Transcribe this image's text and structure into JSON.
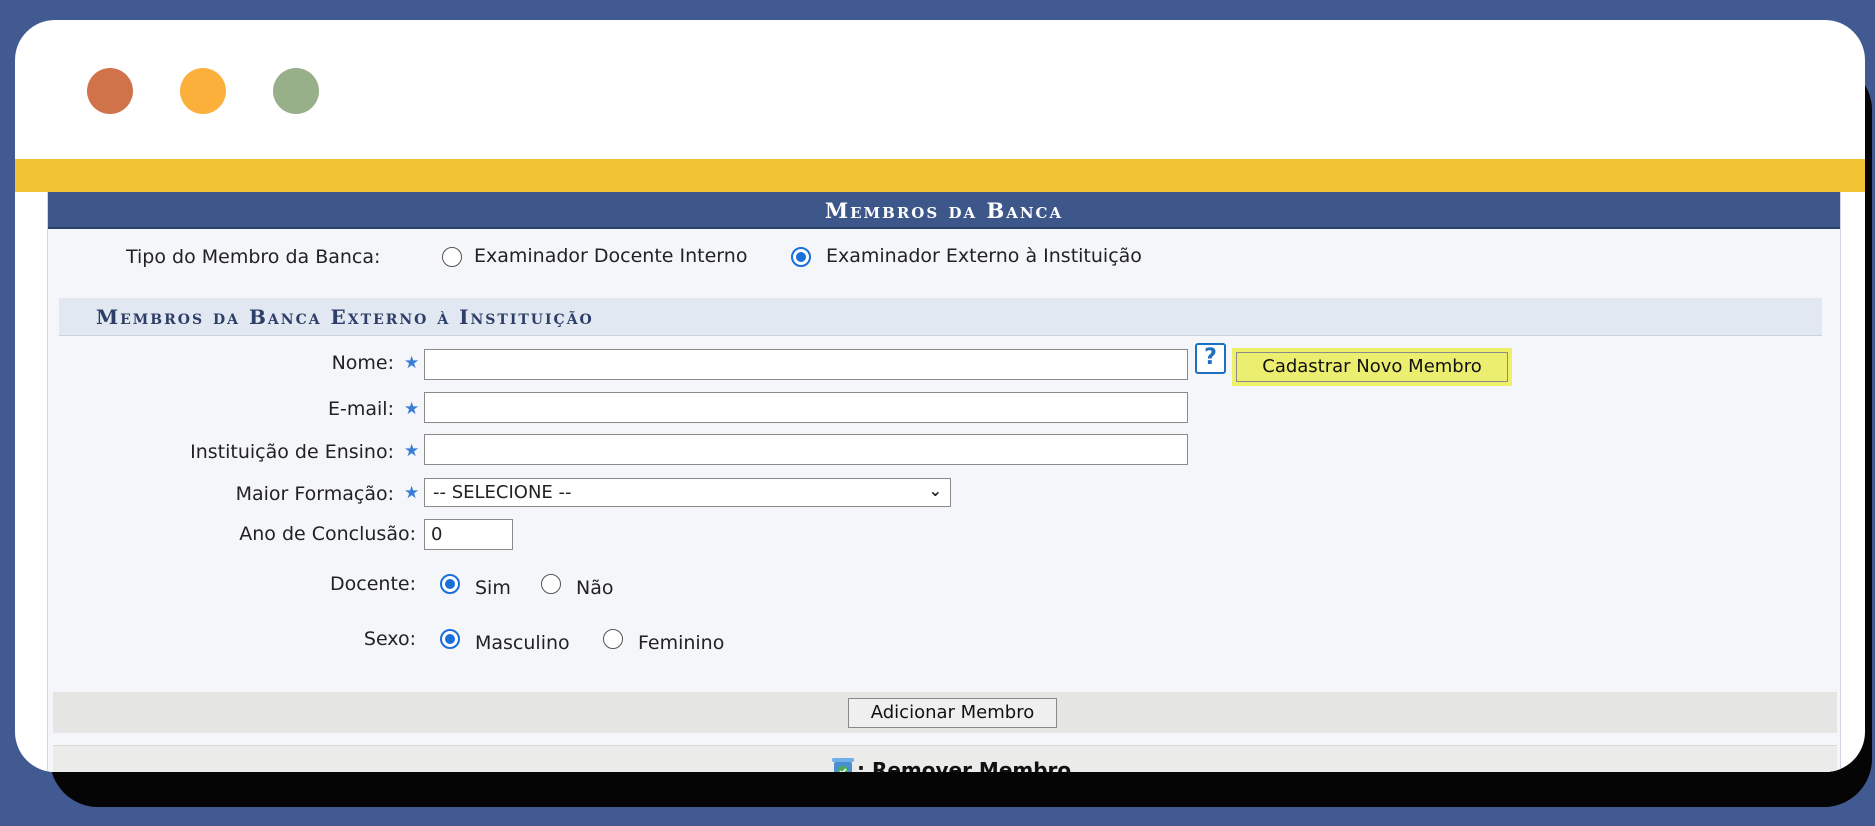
{
  "panel": {
    "title": "Membros da Banca"
  },
  "tipo": {
    "label": "Tipo do Membro da Banca:",
    "options": [
      "Examinador Docente Interno",
      "Examinador Externo à Instituição"
    ],
    "selected": "Examinador Externo à Instituição"
  },
  "subsection": {
    "title": "Membros da Banca Externo à Instituição"
  },
  "form": {
    "nome_label": "Nome:",
    "nome_value": "",
    "email_label": "E-mail:",
    "email_value": "",
    "instituicao_label": "Instituição de Ensino:",
    "instituicao_value": "",
    "formacao_label": "Maior Formação:",
    "formacao_selected": "-- SELECIONE --",
    "ano_label": "Ano de Conclusão:",
    "ano_value": "0",
    "docente_label": "Docente:",
    "docente_options": [
      "Sim",
      "Não"
    ],
    "docente_selected": "Sim",
    "sexo_label": "Sexo:",
    "sexo_options": [
      "Masculino",
      "Feminino"
    ],
    "sexo_selected": "Masculino",
    "help_glyph": "?",
    "cadastrar_label": "Cadastrar Novo Membro",
    "adicionar_label": "Adicionar Membro"
  },
  "remove": {
    "label": ": Remover Membro",
    "icon": "trash-icon"
  },
  "colors": {
    "background": "#415b92",
    "accent": "#f2c434",
    "panel_header": "#3e578a",
    "highlight": "#ecee70",
    "dot_red": "#d0734a",
    "dot_yellow": "#fbb03b",
    "dot_green": "#98b08a"
  }
}
